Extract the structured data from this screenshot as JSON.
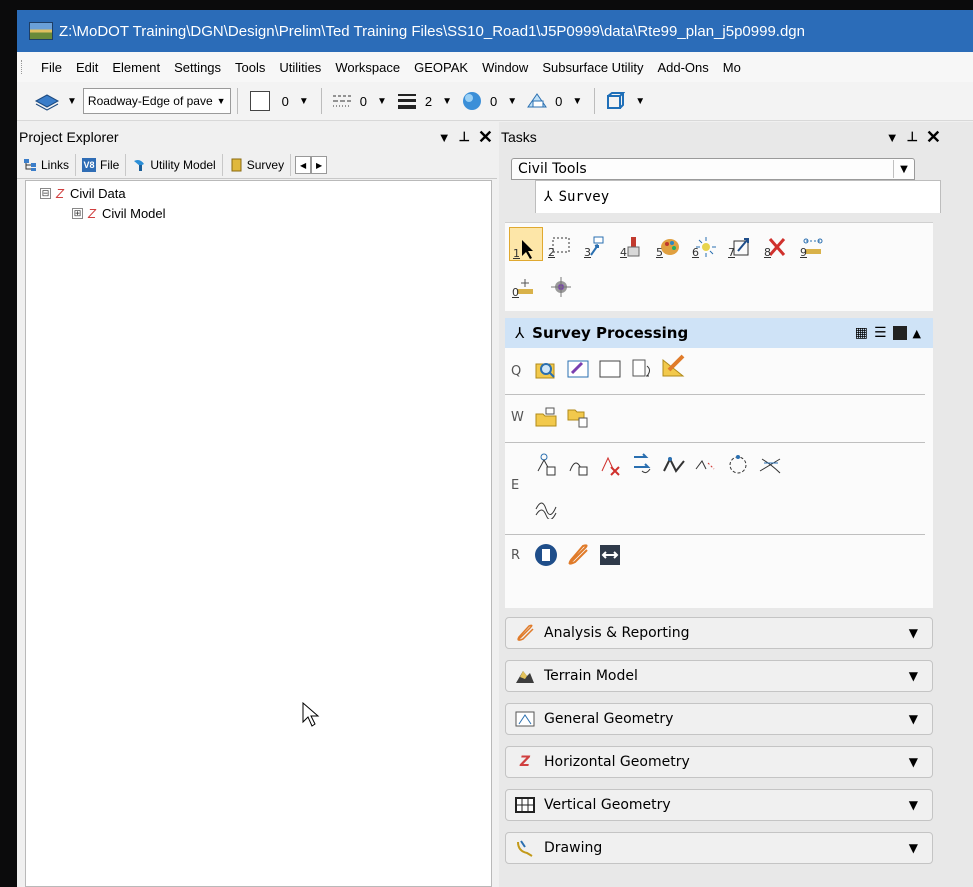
{
  "window": {
    "title": "Z:\\MoDOT Training\\DGN\\Design\\Prelim\\Ted Training Files\\SS10_Road1\\J5P0999\\data\\Rte99_plan_j5p0999.dgn"
  },
  "menu": [
    "File",
    "Edit",
    "Element",
    "Settings",
    "Tools",
    "Utilities",
    "Workspace",
    "GEOPAK",
    "Window",
    "Subsurface Utility",
    "Add-Ons",
    "Mo"
  ],
  "toolbar": {
    "level": "Roadway-Edge of pave",
    "color_index": "0",
    "linestyle_index": "0",
    "weight_index": "2",
    "transparency_index": "0",
    "priority_index": "0"
  },
  "project_explorer": {
    "title": "Project Explorer",
    "tabs": [
      "Links",
      "File",
      "Utility Model",
      "Survey"
    ],
    "tree": [
      {
        "label": "Civil Data",
        "expander": "⊟"
      },
      {
        "label": "Civil Model",
        "expander": "⊞"
      }
    ]
  },
  "tasks": {
    "title": "Tasks",
    "civil_tools": "Civil Tools",
    "survey_tab": "Survey",
    "tool_numbers": [
      "1",
      "2",
      "3",
      "4",
      "5",
      "6",
      "7",
      "8",
      "9",
      "0"
    ],
    "survey_processing": "Survey Processing",
    "group_letters": [
      "Q",
      "W",
      "E",
      "R"
    ],
    "categories": [
      "Analysis & Reporting",
      "Terrain Model",
      "General Geometry",
      "Horizontal Geometry",
      "Vertical Geometry",
      "Drawing"
    ]
  },
  "colors": {
    "titlebar": "#2b6cb8",
    "survey_processing_header": "#cfe3f7"
  }
}
